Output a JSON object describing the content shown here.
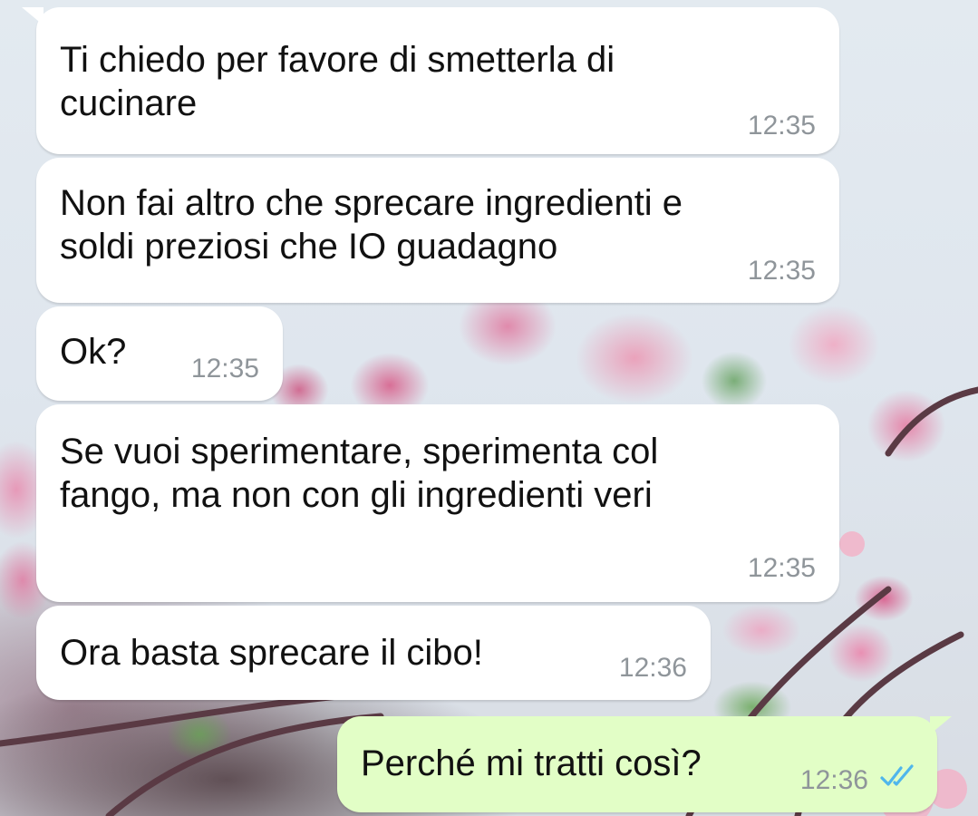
{
  "messages": [
    {
      "direction": "incoming",
      "lines": [
        "Ti chiedo per favore di smetterla di",
        "cucinare"
      ],
      "time": "12:35"
    },
    {
      "direction": "incoming",
      "lines": [
        "Non fai altro che sprecare ingredienti e",
        "soldi preziosi che IO guadagno"
      ],
      "time": "12:35"
    },
    {
      "direction": "incoming",
      "lines": [
        "Ok?"
      ],
      "time": "12:35"
    },
    {
      "direction": "incoming",
      "lines": [
        "Se vuoi sperimentare, sperimenta col",
        "fango, ma non con gli ingredienti veri"
      ],
      "time": "12:35"
    },
    {
      "direction": "incoming",
      "lines": [
        "Ora basta sprecare il cibo!"
      ],
      "time": "12:36"
    },
    {
      "direction": "outgoing",
      "lines": [
        "Perché mi tratti così?"
      ],
      "time": "12:36",
      "status": "read",
      "status_icon": "double-check-icon",
      "status_color": "#4fb6ec"
    }
  ],
  "colors": {
    "incoming_bubble": "#ffffff",
    "outgoing_bubble": "#e2fec6",
    "timestamp": "#8f959a",
    "read_ticks": "#4fb6ec"
  },
  "background": {
    "type": "wallpaper",
    "subject": "pink blossoms"
  }
}
